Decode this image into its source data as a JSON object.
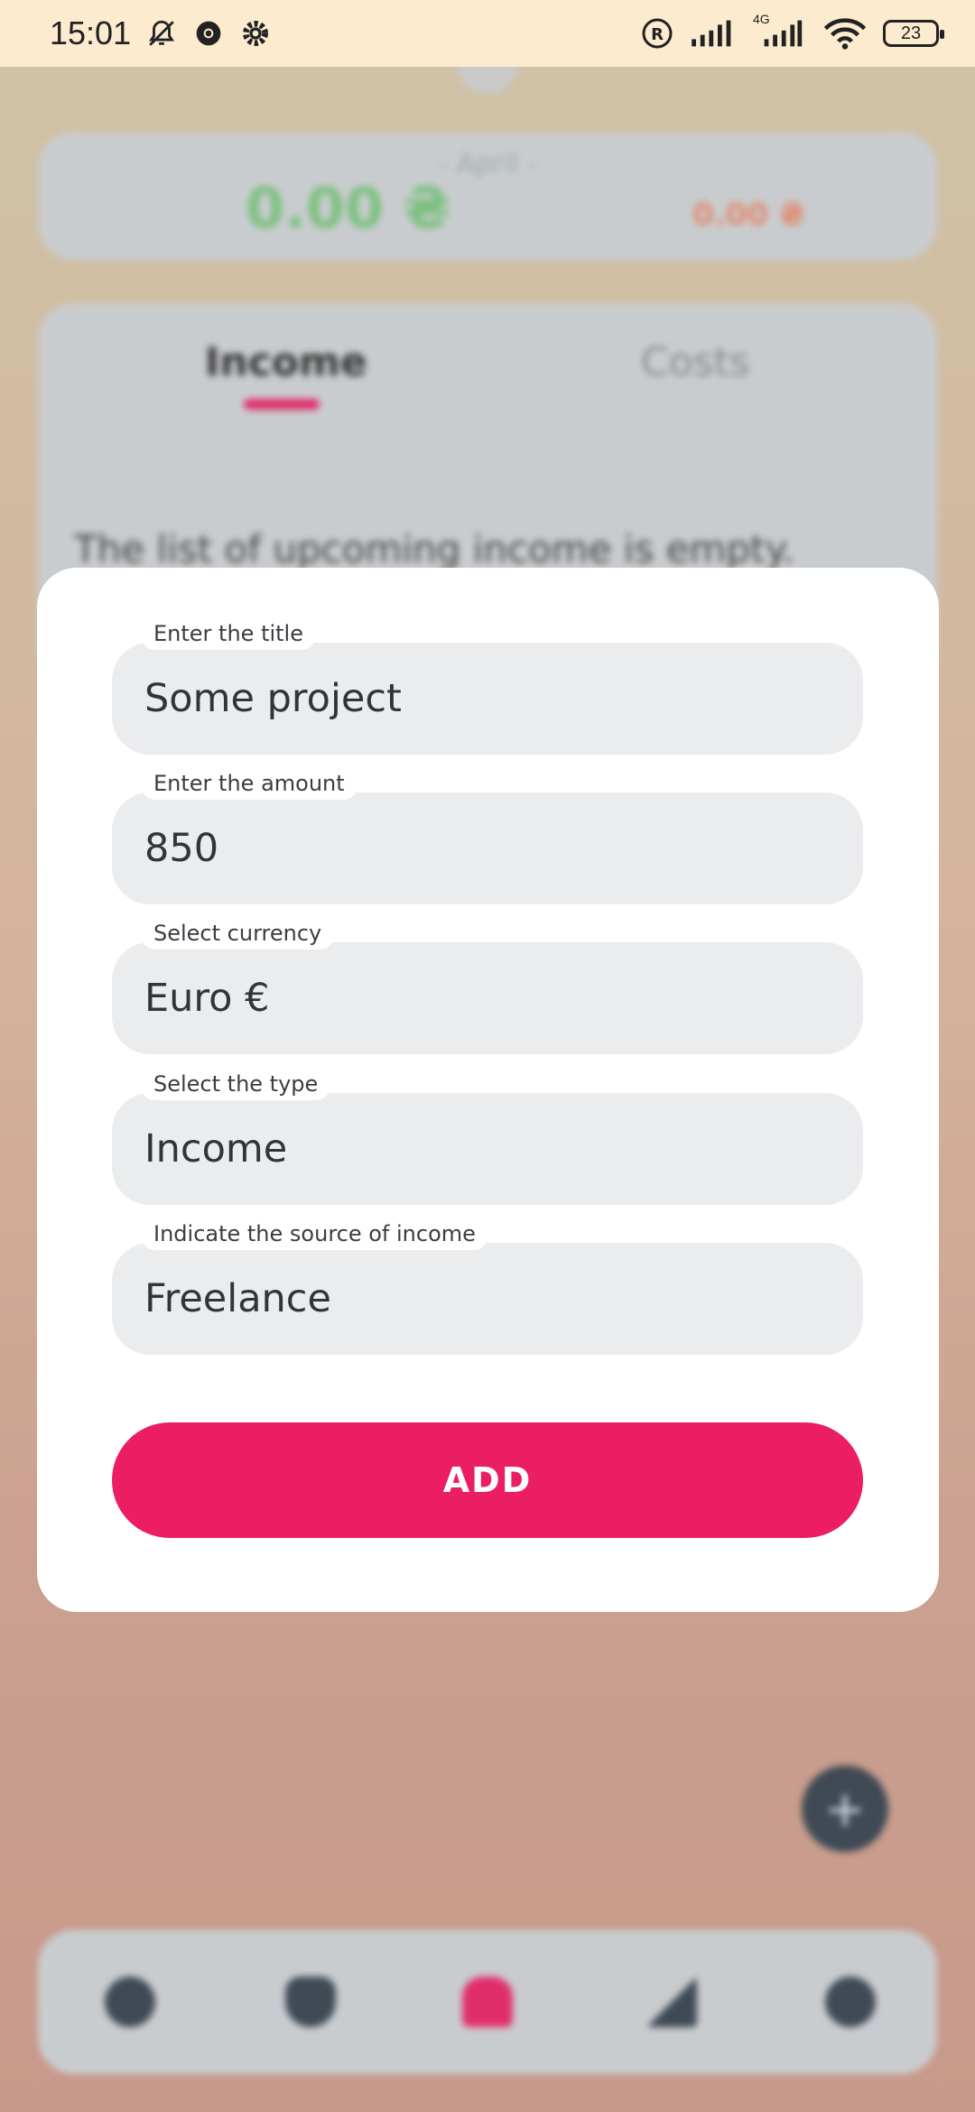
{
  "status_bar": {
    "time": "15:01",
    "battery": "23",
    "network": "4G",
    "icons": [
      "muted-bell-icon",
      "chrome-icon",
      "settings-icon",
      "registered-icon",
      "signal-icon",
      "signal-4g-icon",
      "wifi-icon",
      "battery-icon"
    ]
  },
  "background": {
    "month": "- April -",
    "income_total": "0.00 ₴",
    "costs_total": "0.00 ₴",
    "tabs": [
      "Income",
      "Costs"
    ],
    "empty_message": "The list of upcoming income is empty.",
    "fab_icon": "plus-icon",
    "nav_icons": [
      "wallet-icon",
      "heart-icon",
      "home-icon",
      "stats-icon",
      "settings-icon"
    ]
  },
  "form": {
    "fields": [
      {
        "label": "Enter the title",
        "value": "Some project"
      },
      {
        "label": "Enter the amount",
        "value": "850"
      },
      {
        "label": "Select currency",
        "value": "Euro €"
      },
      {
        "label": "Select the type",
        "value": "Income"
      },
      {
        "label": "Indicate the source of income",
        "value": "Freelance"
      }
    ],
    "submit_label": "ADD"
  },
  "colors": {
    "accent": "#EB1E63",
    "field_bg": "#EBECEE",
    "statusbar_bg": "#FDEBD0"
  }
}
